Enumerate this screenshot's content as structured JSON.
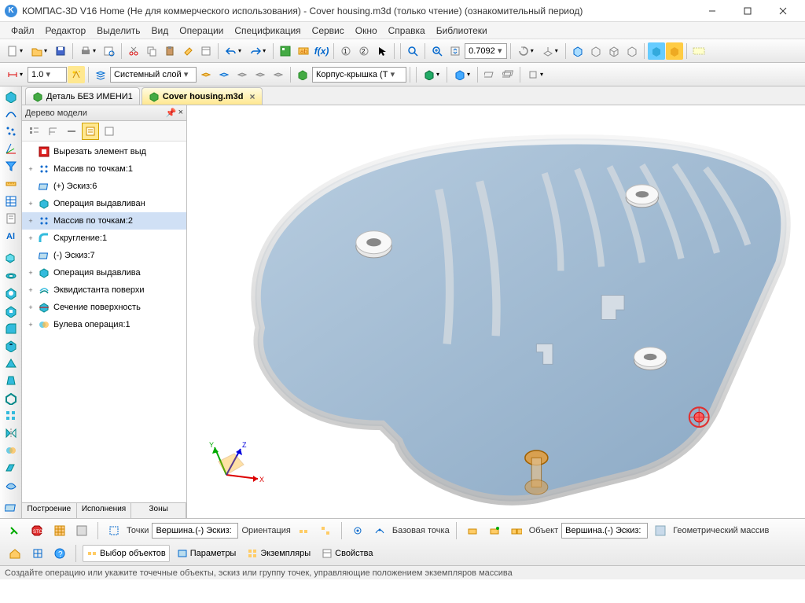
{
  "window": {
    "title": "КОМПАС-3D V16 Home  (Не для коммерческого использования) - Cover housing.m3d (только чтение) (ознакомительный период)"
  },
  "menu": {
    "items": [
      "Файл",
      "Редактор",
      "Выделить",
      "Вид",
      "Операции",
      "Спецификация",
      "Сервис",
      "Окно",
      "Справка",
      "Библиотеки"
    ]
  },
  "toolbar1": {
    "zoom_value": "0.7092"
  },
  "toolbar2": {
    "lineweight": "1.0",
    "layer": "Системный слой",
    "part": "Корпус-крышка (Т"
  },
  "tabs": {
    "items": [
      {
        "label": "Деталь БЕЗ ИМЕНИ1",
        "active": false
      },
      {
        "label": "Cover housing.m3d",
        "active": true
      }
    ]
  },
  "tree": {
    "title": "Дерево модели",
    "items": [
      {
        "icon": "cut",
        "label": "Вырезать элемент выд"
      },
      {
        "icon": "pattern",
        "label": "Массив по точкам:1"
      },
      {
        "icon": "sketch",
        "label": "(+) Эскиз:6"
      },
      {
        "icon": "extrude",
        "label": "Операция выдавливан"
      },
      {
        "icon": "pattern",
        "label": "Массив по точкам:2",
        "selected": true
      },
      {
        "icon": "fillet",
        "label": "Скругление:1"
      },
      {
        "icon": "sketch",
        "label": "(-) Эскиз:7"
      },
      {
        "icon": "extrude",
        "label": "Операция выдавлива"
      },
      {
        "icon": "offset",
        "label": "Эквидистанта поверхи"
      },
      {
        "icon": "section",
        "label": "Сечение поверхность"
      },
      {
        "icon": "bool",
        "label": "Булева операция:1"
      }
    ],
    "footer": [
      "Построение",
      "Исполнения",
      "Зоны"
    ]
  },
  "bottom": {
    "points_label": "Точки",
    "vertex_sketch": "Вершина.(-) Эскиз:",
    "orientation_label": "Ориентация",
    "base_point_label": "Базовая точка",
    "object_label": "Объект",
    "vertex_sketch2": "Вершина.(-) Эскиз:",
    "geo_array_label": "Геометрический массив",
    "tab_select": "Выбор объектов",
    "tab_params": "Параметры",
    "tab_instances": "Экземпляры",
    "tab_props": "Свойства"
  },
  "status": {
    "text": "Создайте операцию или укажите точечные объекты, эскиз или группу точек, управляющие положением экземпляров массива"
  },
  "axis": {
    "x": "X",
    "y": "Y",
    "z": "Z"
  }
}
